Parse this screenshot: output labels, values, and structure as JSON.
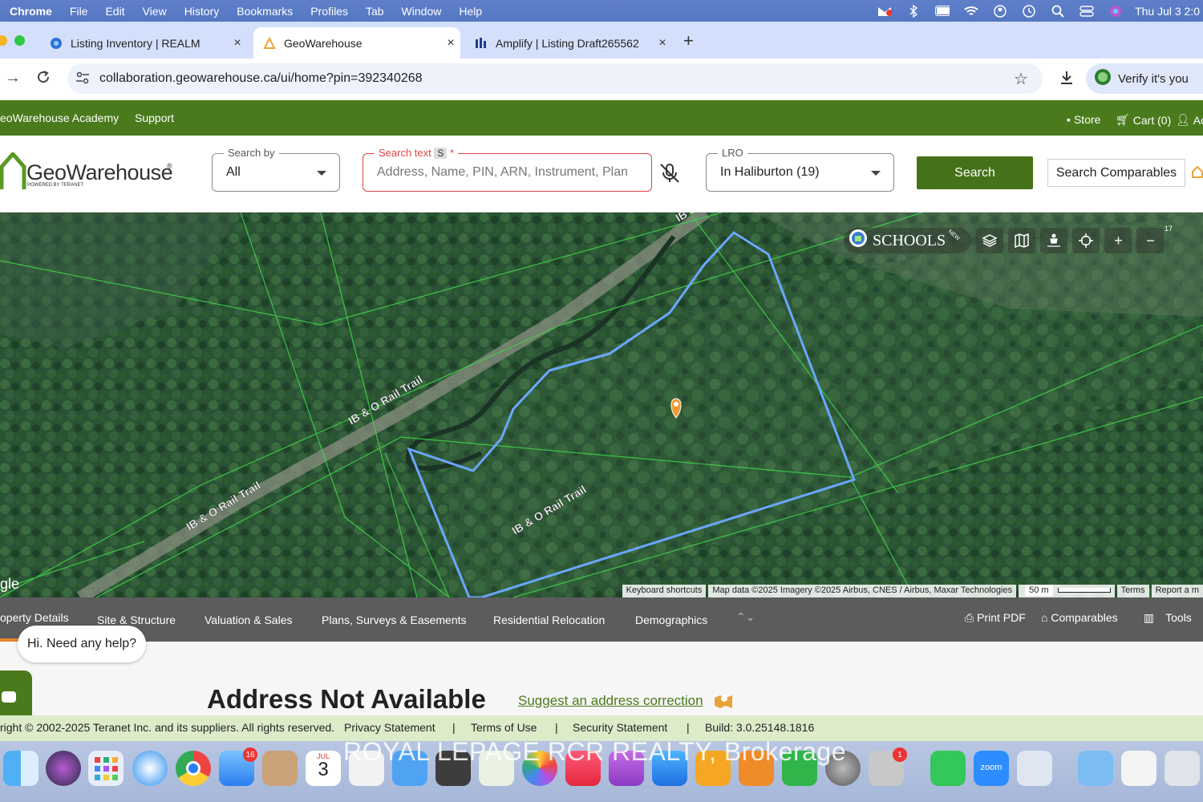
{
  "menubar": {
    "items": [
      "Chrome",
      "File",
      "Edit",
      "View",
      "History",
      "Bookmarks",
      "Profiles",
      "Tab",
      "Window",
      "Help"
    ],
    "clock": "Thu Jul 3  2:0"
  },
  "tabs": [
    {
      "label": "Listing Inventory | REALM"
    },
    {
      "label": "GeoWarehouse"
    },
    {
      "label": "Amplify | Listing Draft265562"
    }
  ],
  "omnibox": {
    "url": "collaboration.geowarehouse.ca/ui/home?pin=392340268",
    "verify_label": "Verify it's you"
  },
  "greenbar": {
    "academy": "eoWarehouse Academy",
    "support": "Support",
    "store": "Store",
    "cart": "Cart (0)",
    "account": "Acc"
  },
  "logo": {
    "name": "GeoWarehouse",
    "tagline": "POWERED BY TERANET",
    "reg": "®"
  },
  "search": {
    "search_by_legend": "Search by",
    "search_by_value": "All",
    "search_text_legend": "Search text",
    "search_text_key": "S",
    "search_text_required": "*",
    "search_text_placeholder": "Address, Name, PIN, ARN, Instrument, Plan",
    "lro_legend": "LRO",
    "lro_value": "In Haliburton (19)",
    "search_button": "Search",
    "comparables_button": "Search Comparables"
  },
  "map": {
    "schools_label": "SCHOOLS",
    "schools_badge": "NEW",
    "counter": "17",
    "trail_labels": [
      "IB & O Rail Trail",
      "IB & O Rail Trail",
      "IB & O Rail Trail",
      "IB &"
    ],
    "google_partial": "gle",
    "attribution": {
      "keyboard": "Keyboard shortcuts",
      "mapdata": "Map data ©2025 Imagery ©2025 Airbus, CNES / Airbus, Maxar Technologies",
      "scale": "50 m",
      "terms": "Terms",
      "report": "Report a m"
    },
    "colors": {
      "parcel": "#6aa7ff",
      "lot_lines": "#3fd14a",
      "marker": "#f29a2e"
    }
  },
  "detail_tabs": [
    "operty Details",
    "Site & Structure",
    "Valuation & Sales",
    "Plans, Surveys & Easements",
    "Residential Relocation",
    "Demographics"
  ],
  "detail_actions": {
    "print": "Print PDF",
    "comparables": "Comparables",
    "tools": "Tools"
  },
  "content": {
    "address": "Address Not Available",
    "suggest": "Suggest an address correction",
    "help": "Hi. Need any help?"
  },
  "footer": {
    "copyright": "right © 2002-2025 Teranet Inc. and its suppliers. All rights reserved.",
    "privacy": "Privacy Statement",
    "terms": "Terms of Use",
    "security": "Security Statement",
    "build": "Build: 3.0.25148.1816",
    "sep": "|"
  },
  "dock": {
    "calendar_month": "JUL",
    "calendar_day": "3",
    "mail_badge": "16",
    "printer_badge": "1",
    "zoom_label": "zoom"
  },
  "watermark": "ROYAL LEPAGE RCR REALTY, Brokerage"
}
